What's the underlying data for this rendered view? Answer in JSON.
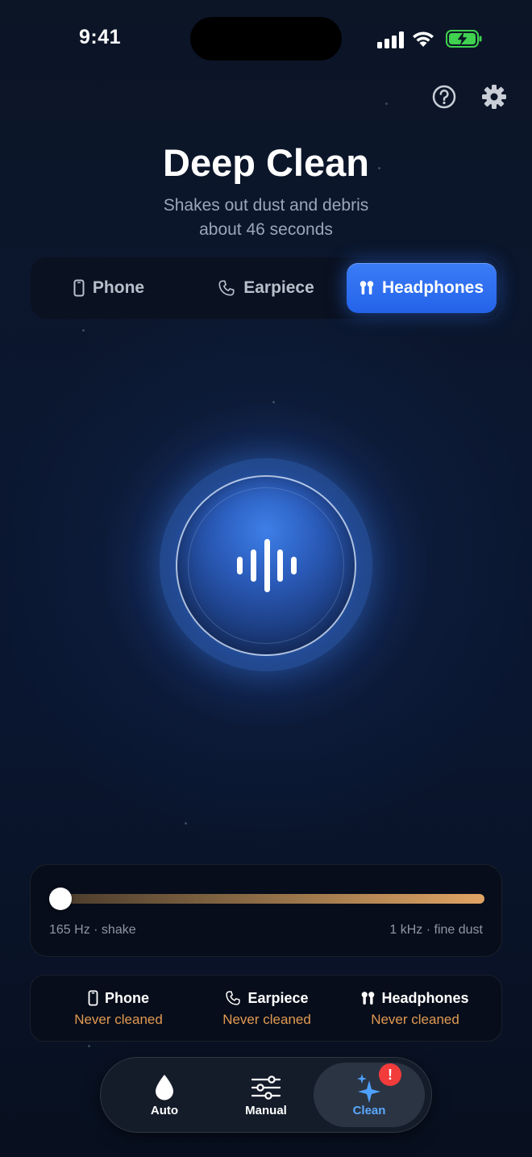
{
  "status_bar": {
    "time": "9:41"
  },
  "header": {
    "title": "Deep Clean",
    "subtitle_line1": "Shakes out dust and debris",
    "subtitle_line2": "about 46 seconds"
  },
  "segments": {
    "items": [
      {
        "label": "Phone",
        "icon": "phone-icon"
      },
      {
        "label": "Earpiece",
        "icon": "earpiece-icon"
      },
      {
        "label": "Headphones",
        "icon": "headphones-icon"
      }
    ],
    "selected": "Headphones"
  },
  "clean_button": {
    "icon": "waveform-icon"
  },
  "frequency": {
    "min_label": "165 Hz · shake",
    "max_label": "1 kHz · fine dust",
    "position": 0.0
  },
  "device_status": [
    {
      "name": "Phone",
      "value": "Never cleaned",
      "icon": "phone-icon"
    },
    {
      "name": "Earpiece",
      "value": "Never cleaned",
      "icon": "earpiece-icon"
    },
    {
      "name": "Headphones",
      "value": "Never cleaned",
      "icon": "headphones-icon"
    }
  ],
  "tabs": [
    {
      "label": "Auto",
      "icon": "drop-icon"
    },
    {
      "label": "Manual",
      "icon": "sliders-icon"
    },
    {
      "label": "Clean",
      "icon": "sparkles-icon"
    }
  ],
  "tab_badge": "!",
  "colors": {
    "accent": "#2f6ff0",
    "warning": "#e19a52",
    "badge": "#f23b3b",
    "active_tab": "#5aa8ff"
  }
}
